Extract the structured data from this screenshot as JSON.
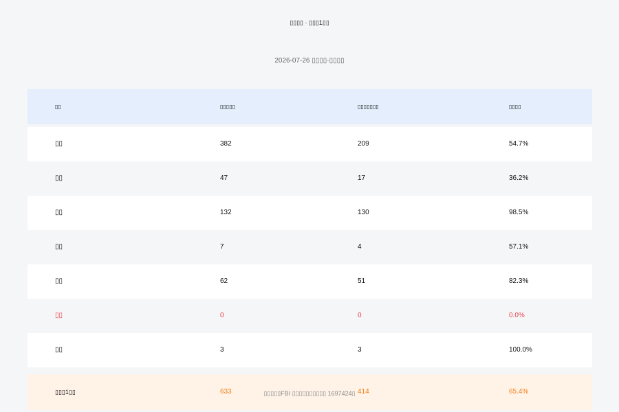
{
  "page": {
    "title": "▯▯▯▯ · ▯▯▯1▯▯",
    "subtitle": "2026-07-26 ▯▯▯▯·▯▯▯▯",
    "footer_note": "▯▯▯▯▯FBI ▯▯▯▯▯▯▯▯▯▯ 1697424▯"
  },
  "table": {
    "headers": [
      "▯▯",
      "▯▯▯▯▯",
      "▯▯▯▯▯▯▯",
      "▯▯▯▯"
    ],
    "rows": [
      {
        "name": "▯▯",
        "total": "382",
        "done": "209",
        "rate": "54.7%"
      },
      {
        "name": "▯▯",
        "total": "47",
        "done": "17",
        "rate": "36.2%"
      },
      {
        "name": "▯▯",
        "total": "132",
        "done": "130",
        "rate": "98.5%"
      },
      {
        "name": "▯▯",
        "total": "7",
        "done": "4",
        "rate": "57.1%"
      },
      {
        "name": "▯▯",
        "total": "62",
        "done": "51",
        "rate": "82.3%"
      },
      {
        "name": "▯▯",
        "total": "0",
        "done": "0",
        "rate": "0.0%"
      },
      {
        "name": "▯▯",
        "total": "3",
        "done": "3",
        "rate": "100.0%"
      }
    ],
    "total_row": {
      "name": "▯▯▯1▯▯",
      "total": "633",
      "done": "414",
      "rate": "65.4%"
    }
  },
  "colors": {
    "header_bg": "#e4eefd",
    "alert_text": "#e8424a",
    "total_bg": "#fff3e8",
    "total_text": "#f07d14"
  }
}
